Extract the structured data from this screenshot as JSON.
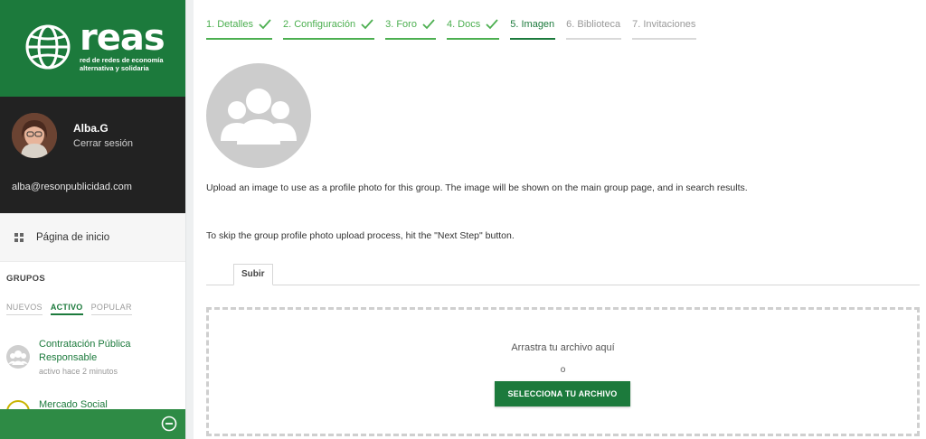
{
  "brand": {
    "name": "reas",
    "tagline_line1": "red de redes de economía",
    "tagline_line2": "alternativa y solidaria",
    "color": "#1c7a3c"
  },
  "user": {
    "name": "Alba.G",
    "logout_label": "Cerrar sesión",
    "email": "alba@resonpublicidad.com"
  },
  "nav": {
    "home_label": "Página de inicio",
    "home_icon": "grid-icon"
  },
  "groups": {
    "title": "GRUPOS",
    "tabs": [
      {
        "label": "NUEVOS",
        "active": false
      },
      {
        "label": "ACTIVO",
        "active": true
      },
      {
        "label": "POPULAR",
        "active": false
      }
    ],
    "items": [
      {
        "title": "Contratación Pública Responsable",
        "meta": "activo hace 2 minutos"
      },
      {
        "title": "Mercado Social",
        "meta": ""
      }
    ]
  },
  "footer": {
    "collapse_icon": "minus-circle-icon"
  },
  "steps": [
    {
      "label": "1. Detalles",
      "state": "done"
    },
    {
      "label": "2. Configuración",
      "state": "done"
    },
    {
      "label": "3. Foro",
      "state": "done"
    },
    {
      "label": "4. Docs",
      "state": "done"
    },
    {
      "label": "5. Imagen",
      "state": "current"
    },
    {
      "label": "6. Biblioteca",
      "state": "todo"
    },
    {
      "label": "7. Invitaciones",
      "state": "todo"
    }
  ],
  "main": {
    "description": "Upload an image to use as a profile photo for this group. The image will be shown on the main group page, and in search results.",
    "skip_text": "To skip the group profile photo upload process, hit the \"Next Step\" button.",
    "tab_label": "Subir",
    "drop_text": "Arrastra tu archivo aquí",
    "or_text": "o",
    "select_button": "SELECCIONA TU ARCHIVO"
  }
}
